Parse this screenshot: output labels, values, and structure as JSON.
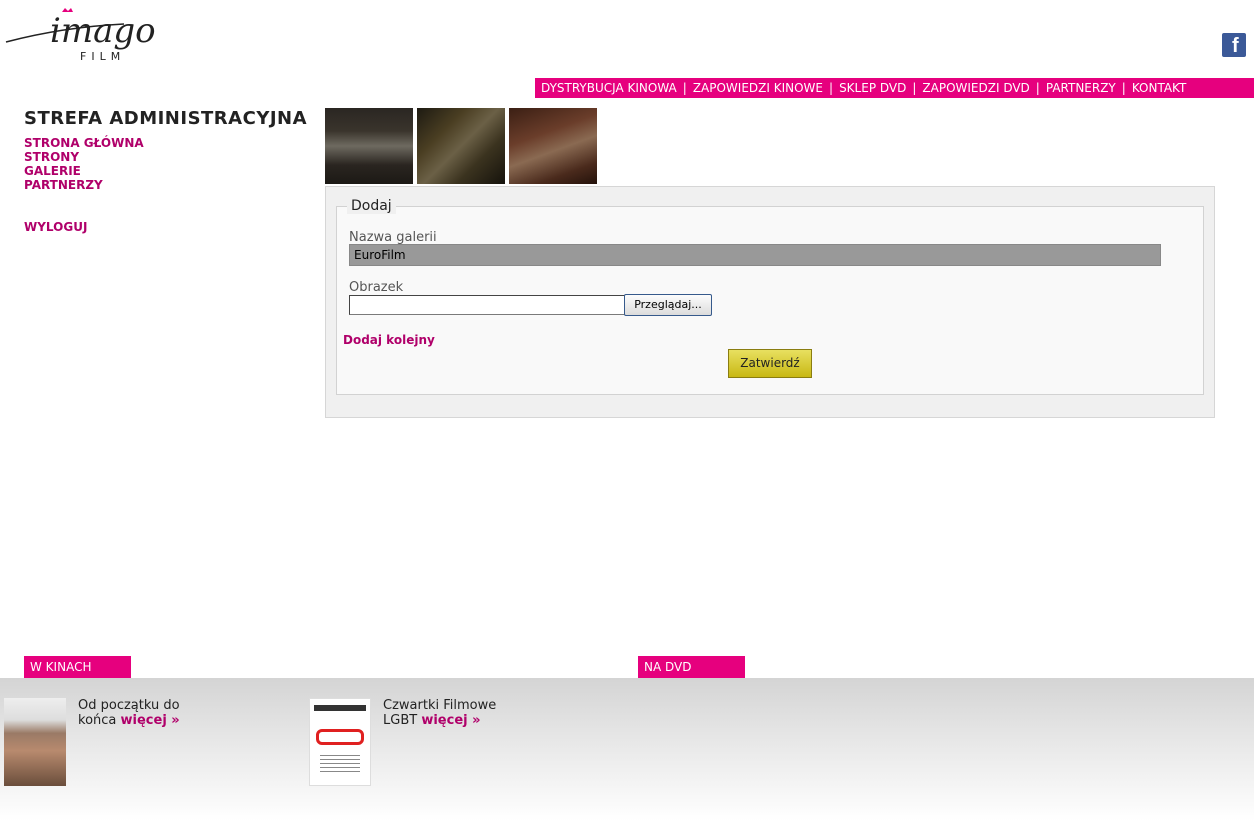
{
  "brand": {
    "logo_main": "imago",
    "logo_sub": "FILM"
  },
  "social": {
    "icon": "facebook-icon"
  },
  "topnav": {
    "items": [
      "DYSTRYBUCJA KINOWA",
      "ZAPOWIEDZI KINOWE",
      "SKLEP DVD",
      "ZAPOWIEDZI DVD",
      "PARTNERZY",
      "KONTAKT"
    ],
    "separator": "|"
  },
  "sidebar": {
    "title": "STREFA ADMINISTRACYJNA",
    "items": [
      "STRONA GŁÓWNA",
      "STRONY",
      "GALERIE",
      "PARTNERZY"
    ],
    "logout": "WYLOGUJ"
  },
  "form": {
    "legend": "Dodaj",
    "gallery_label": "Nazwa galerii",
    "gallery_value": "EuroFilm",
    "image_label": "Obrazek",
    "browse_label": "Przeglądaj...",
    "add_more": "Dodaj kolejny",
    "submit_label": "Zatwierdź"
  },
  "tabs": {
    "cinema": "W KINACH",
    "dvd": "NA DVD"
  },
  "cards": [
    {
      "line1": "Od początku do",
      "line2": "końca",
      "more": "więcej »"
    },
    {
      "line1": "Czwartki Filmowe",
      "line2": "LGBT",
      "more": "więcej »"
    }
  ],
  "colors": {
    "accent": "#e6007e",
    "link": "#b0006a",
    "submit": "#d8cc30"
  }
}
